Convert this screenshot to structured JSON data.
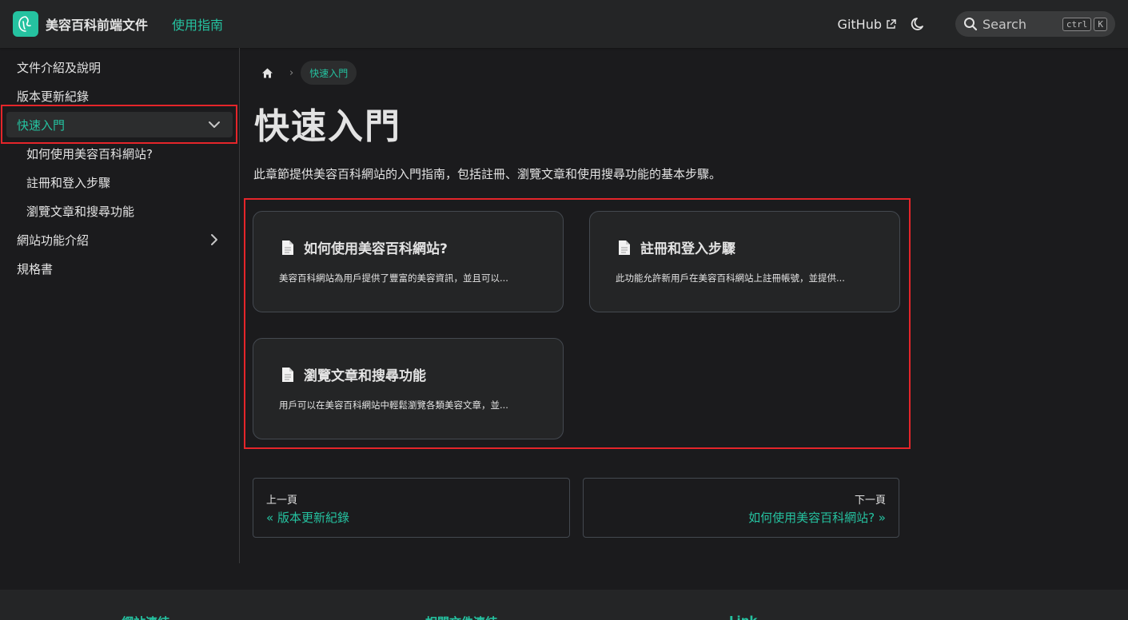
{
  "navbar": {
    "brand_title": "美容百科前端文件",
    "nav_link": "使用指南",
    "github": "GitHub",
    "search_placeholder": "Search",
    "kbd_ctrl": "ctrl",
    "kbd_k": "K"
  },
  "sidebar": {
    "items": [
      {
        "label": "文件介紹及說明"
      },
      {
        "label": "版本更新紀錄"
      },
      {
        "label": "快速入門"
      },
      {
        "label": "如何使用美容百科網站?"
      },
      {
        "label": "註冊和登入步驟"
      },
      {
        "label": "瀏覽文章和搜尋功能"
      },
      {
        "label": "網站功能介紹"
      },
      {
        "label": "規格書"
      }
    ]
  },
  "breadcrumb": {
    "current": "快速入門"
  },
  "main": {
    "title": "快速入門",
    "description": "此章節提供美容百科網站的入門指南，包括註冊、瀏覽文章和使用搜尋功能的基本步驟。",
    "cards": [
      {
        "title": "如何使用美容百科網站?",
        "desc": "美容百科網站為用戶提供了豐富的美容資訊，並且可以..."
      },
      {
        "title": "註冊和登入步驟",
        "desc": "此功能允許新用戶在美容百科網站上註冊帳號，並提供..."
      },
      {
        "title": "瀏覽文章和搜尋功能",
        "desc": "用戶可以在美容百科網站中輕鬆瀏覽各類美容文章，並..."
      }
    ]
  },
  "pagination": {
    "prev_sub": "上一頁",
    "prev_label": "« 版本更新紀錄",
    "next_sub": "下一頁",
    "next_label": "如何使用美容百科網站? »"
  },
  "footer": {
    "col1": "網站連結",
    "col2": "相關文件連結",
    "col3": "Link"
  },
  "colors": {
    "accent": "#25c2a0",
    "background": "#1b1b1d",
    "highlight": "#e5252a"
  }
}
